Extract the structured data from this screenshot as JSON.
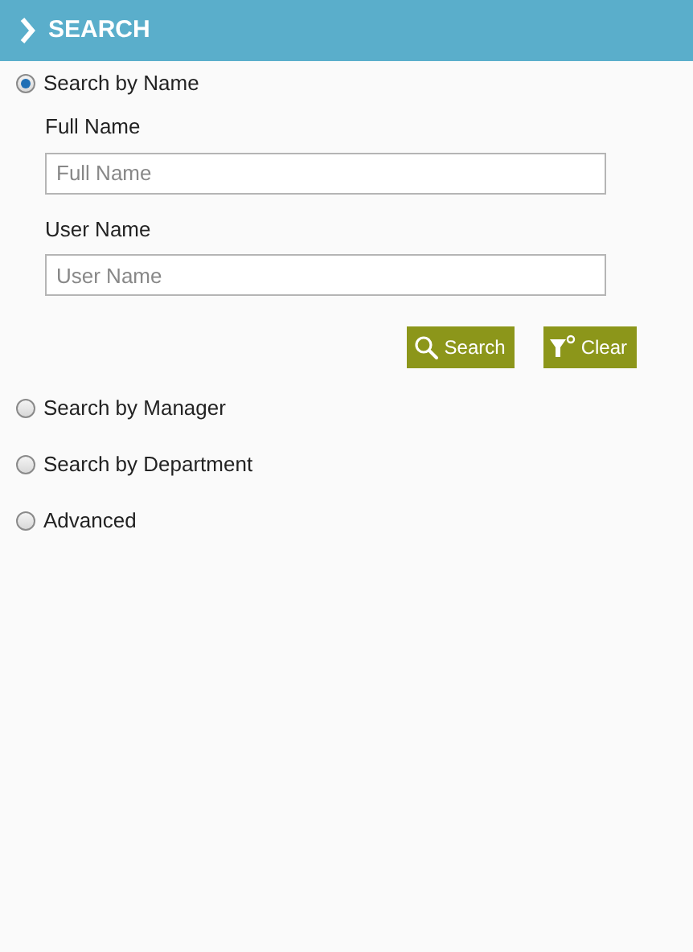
{
  "header": {
    "title": "SEARCH"
  },
  "options": [
    {
      "label": "Search by Name",
      "selected": true,
      "fields": [
        {
          "label": "Full Name",
          "placeholder": "Full Name"
        },
        {
          "label": "User Name",
          "placeholder": "User Name"
        }
      ],
      "buttons": [
        {
          "kind": "search",
          "label": "Search"
        },
        {
          "kind": "clear",
          "label": "Clear"
        }
      ]
    },
    {
      "label": "Search by Manager",
      "selected": false
    },
    {
      "label": "Search by Department",
      "selected": false
    },
    {
      "label": "Advanced",
      "selected": false
    }
  ]
}
